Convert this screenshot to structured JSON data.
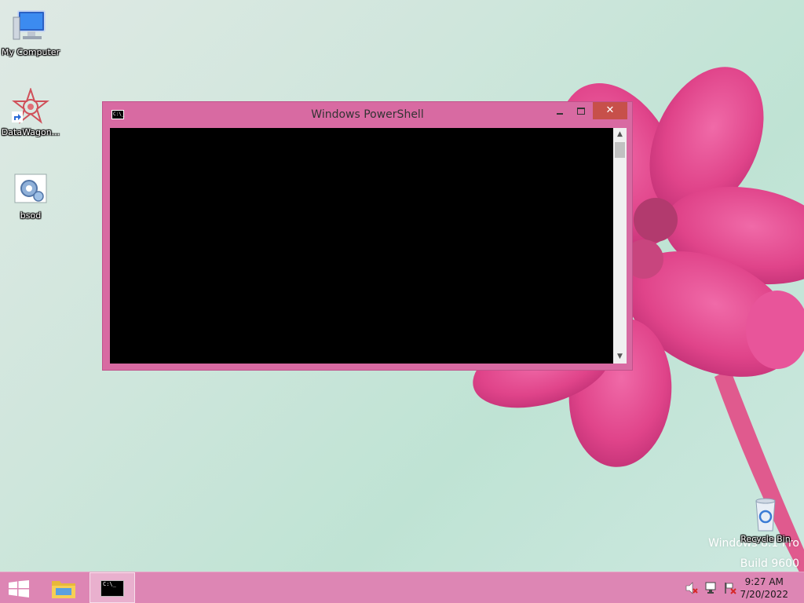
{
  "desktop": {
    "icons": [
      {
        "label": "My Computer"
      },
      {
        "label": "DataWagon..."
      },
      {
        "label": "bsod"
      },
      {
        "label": "Recycle Bin"
      }
    ],
    "watermark": {
      "line1": "Windows 8.1 Pro",
      "line2": "Build 9600"
    }
  },
  "window": {
    "title": "Windows PowerShell",
    "icon_text": "C:\\_",
    "close_glyph": "✕",
    "scroll_up": "▲",
    "scroll_down": "▼"
  },
  "taskbar": {
    "ps_icon_text": "C:\\_",
    "clock_time": "9:27 AM",
    "clock_date": "7/20/2022"
  },
  "colors": {
    "window_frame": "#d86aa2",
    "taskbar": "#dd86b4",
    "close_button": "#c7504a",
    "console": "#000000"
  }
}
